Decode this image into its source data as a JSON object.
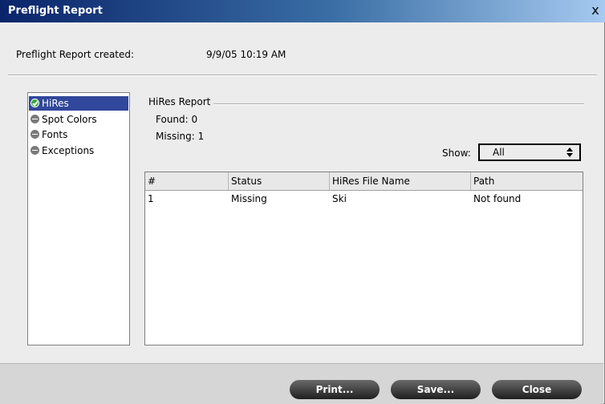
{
  "window": {
    "title": "Preflight Report",
    "close_glyph": "x"
  },
  "header": {
    "created_label": "Preflight Report created:",
    "created_value": "9/9/05 10:19 AM"
  },
  "tree": {
    "items": [
      {
        "label": "HiRes",
        "icon": "check-circle-icon",
        "selected": true
      },
      {
        "label": "Spot Colors",
        "icon": "minus-circle-icon",
        "selected": false
      },
      {
        "label": "Fonts",
        "icon": "minus-circle-icon",
        "selected": false
      },
      {
        "label": "Exceptions",
        "icon": "minus-circle-icon",
        "selected": false
      }
    ]
  },
  "report": {
    "group_title": "HiRes Report",
    "found": "Found: 0",
    "missing": "Missing: 1",
    "show_label": "Show:",
    "show_value": "All"
  },
  "table": {
    "headers": [
      "#",
      "Status",
      "HiRes File Name",
      "Path"
    ],
    "rows": [
      [
        "1",
        "Missing",
        "Ski",
        "Not found"
      ]
    ]
  },
  "footer": {
    "print_label": "Print...",
    "save_label": "Save...",
    "close_label": "Close"
  },
  "colors": {
    "selection": "#31479b",
    "title_start": "#0a246a",
    "title_end": "#a6caf0"
  }
}
